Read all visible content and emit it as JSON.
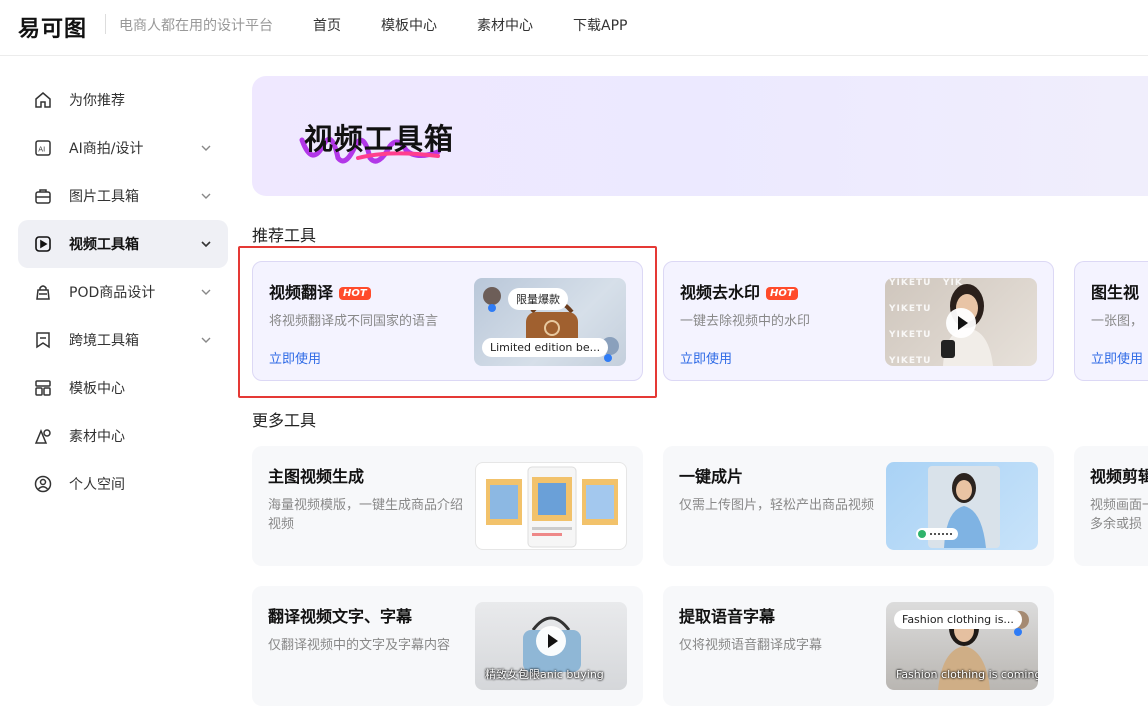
{
  "header": {
    "logo": "易可图",
    "slogan": "电商人都在用的设计平台",
    "nav": [
      "首页",
      "模板中心",
      "素材中心",
      "下载APP"
    ]
  },
  "sidebar": {
    "items": [
      {
        "label": "为你推荐",
        "icon": "home-icon",
        "has_chevron": false
      },
      {
        "label": "AI商拍/设计",
        "icon": "ai-icon",
        "has_chevron": true
      },
      {
        "label": "图片工具箱",
        "icon": "toolbox-icon",
        "has_chevron": true
      },
      {
        "label": "视频工具箱",
        "icon": "video-play-icon",
        "has_chevron": true,
        "active": true
      },
      {
        "label": "POD商品设计",
        "icon": "shopping-bag-icon",
        "has_chevron": true
      },
      {
        "label": "跨境工具箱",
        "icon": "bookmark-icon",
        "has_chevron": true
      },
      {
        "label": "模板中心",
        "icon": "template-grid-icon",
        "has_chevron": false
      },
      {
        "label": "素材中心",
        "icon": "shapes-icon",
        "has_chevron": false
      },
      {
        "label": "个人空间",
        "icon": "user-icon",
        "has_chevron": false
      }
    ]
  },
  "banner": {
    "title": "视频工具箱"
  },
  "sections": {
    "recommended": "推荐工具",
    "more": "更多工具"
  },
  "recommended": [
    {
      "title": "视频翻译",
      "hot": "HOT",
      "desc": "将视频翻译成不同国家的语言",
      "link": "立即使用",
      "thumb_pill_top": "限量爆款",
      "thumb_pill_bottom": "Limited edition be..."
    },
    {
      "title": "视频去水印",
      "hot": "HOT",
      "desc": "一键去除视频中的水印",
      "link": "立即使用",
      "watermark": "YIKETU",
      "watermark_partial": "YIK"
    },
    {
      "title": "图生视频",
      "title_visible": "图生视",
      "desc": "一张图，",
      "link": "立即使用"
    }
  ],
  "more": [
    {
      "title": "主图视频生成",
      "desc": "海量视频模版，一键生成商品介绍视频"
    },
    {
      "title": "一键成片",
      "desc": "仅需上传图片，轻松产出商品视频"
    },
    {
      "title": "视频剪辑",
      "title_visible": "视频剪辑",
      "desc": "视频画面一",
      "desc2": "多余或损"
    },
    {
      "title": "翻译视频文字、字幕",
      "desc": "仅翻译视频中的文字及字幕内容",
      "overlay": "精致女包限anic buying"
    },
    {
      "title": "提取语音字幕",
      "desc": "仅将视频语音翻译成字幕",
      "pill": "Fashion clothing is...",
      "overlay": "Fashion clothing is coming"
    }
  ],
  "colors": {
    "accent": "#2e6ae6",
    "hot": "#ff4b2b",
    "highlight": "#e53935"
  }
}
